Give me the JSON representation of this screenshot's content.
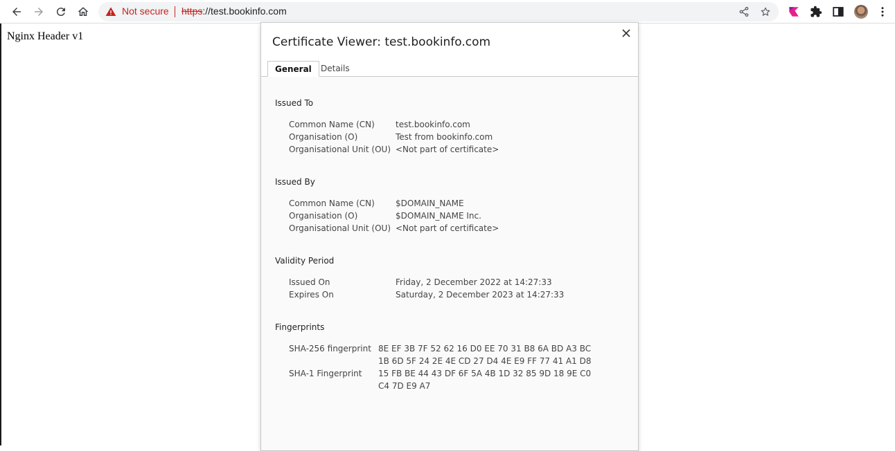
{
  "browser": {
    "security_label": "Not secure",
    "url_scheme": "https",
    "url_rest": "://test.bookinfo.com"
  },
  "page": {
    "heading": "Nginx Header v1"
  },
  "dialog": {
    "title": "Certificate Viewer: test.bookinfo.com",
    "tabs": [
      {
        "label": "General",
        "active": true
      },
      {
        "label": "Details",
        "active": false
      }
    ],
    "issued_to": {
      "title": "Issued To",
      "rows": [
        {
          "label": "Common Name (CN)",
          "value": "test.bookinfo.com"
        },
        {
          "label": "Organisation (O)",
          "value": "Test from bookinfo.com"
        },
        {
          "label": "Organisational Unit (OU)",
          "value": "<Not part of certificate>"
        }
      ]
    },
    "issued_by": {
      "title": "Issued By",
      "rows": [
        {
          "label": "Common Name (CN)",
          "value": "$DOMAIN_NAME"
        },
        {
          "label": "Organisation (O)",
          "value": "$DOMAIN_NAME Inc."
        },
        {
          "label": "Organisational Unit (OU)",
          "value": "<Not part of certificate>"
        }
      ]
    },
    "validity": {
      "title": "Validity Period",
      "rows": [
        {
          "label": "Issued On",
          "value": "Friday, 2 December 2022 at 14:27:33"
        },
        {
          "label": "Expires On",
          "value": "Saturday, 2 December 2023 at 14:27:33"
        }
      ]
    },
    "fingerprints": {
      "title": "Fingerprints",
      "rows": [
        {
          "label": "SHA-256 fingerprint",
          "line1": "8E EF 3B 7F 52 62 16 D0 EE 70 31 B8 6A BD A3 BC",
          "line2": "1B 6D 5F 24 2E 4E CD 27 D4 4E E9 FF 77 41 A1 D8"
        },
        {
          "label": "SHA-1 Fingerprint",
          "line1": "15 FB BE 44 43 DF 6F 5A 4B 1D 32 85 9D 18 9E C0",
          "line2": "C4 7D E9 A7"
        }
      ]
    }
  },
  "colors": {
    "danger": "#c5221f",
    "dialog_bg": "#fafafa",
    "toolbar_icon": "#5f6368"
  },
  "icons": [
    "back-icon",
    "forward-icon",
    "reload-icon",
    "home-icon",
    "warning-icon",
    "share-icon",
    "star-icon",
    "extension-flag-icon",
    "puzzle-icon",
    "side-panel-icon",
    "avatar",
    "kebab-menu-icon",
    "close-icon"
  ]
}
